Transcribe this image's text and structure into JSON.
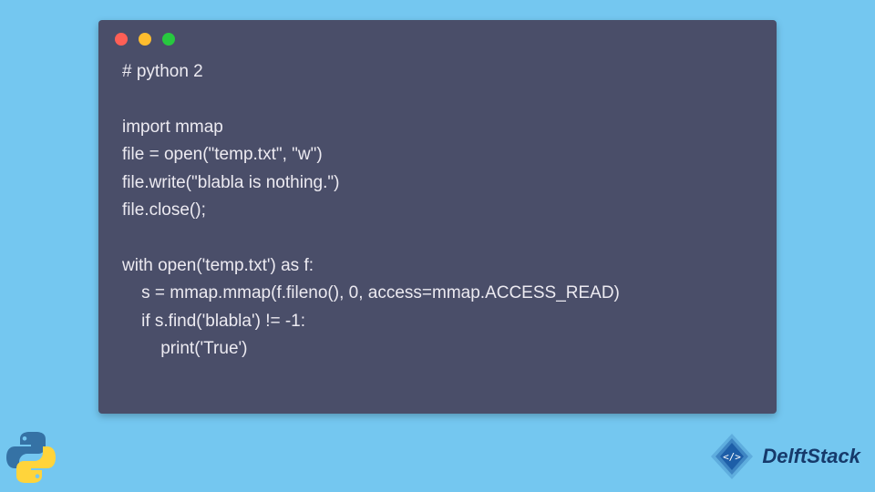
{
  "code_window": {
    "dots": [
      "red",
      "yellow",
      "green"
    ],
    "lines": [
      "# python 2",
      "",
      "import mmap",
      "file = open(\"temp.txt\", \"w\")",
      "file.write(\"blabla is nothing.\")",
      "file.close();",
      "",
      "with open('temp.txt') as f:",
      "    s = mmap.mmap(f.fileno(), 0, access=mmap.ACCESS_READ)",
      "    if s.find('blabla') != -1:",
      "        print('True')"
    ]
  },
  "brand": {
    "name": "DelftStack"
  },
  "icons": {
    "python_logo": "python-logo-icon",
    "brand_logo": "delftstack-logo-icon"
  },
  "colors": {
    "page_bg": "#74c7f0",
    "window_bg": "#4a4e69",
    "code_text": "#eceaf1",
    "brand_text": "#163a6b"
  }
}
